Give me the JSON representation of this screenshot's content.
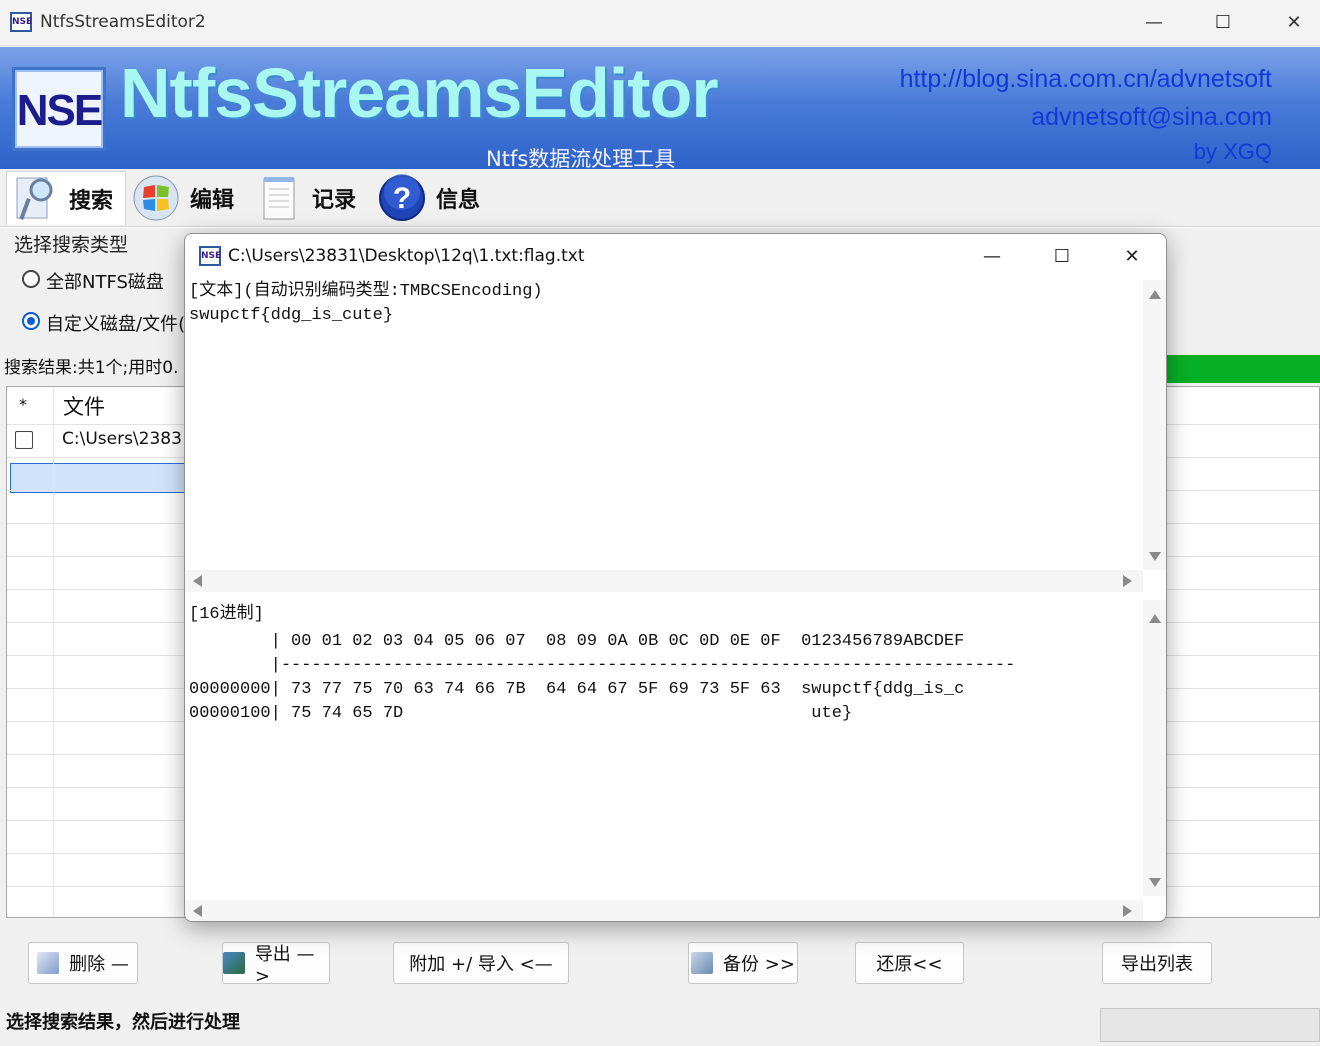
{
  "window": {
    "title": "NtfsStreamsEditor2",
    "minimize": "—",
    "maximize": "☐",
    "close": "✕"
  },
  "banner": {
    "logo_text": "NSE",
    "brand": "NtfsStreamsEditor",
    "subtitle": "Ntfs数据流处理工具",
    "link_blog": "http://blog.sina.com.cn/advnetsoft",
    "link_email": "advnetsoft@sina.com",
    "author": "by XGQ"
  },
  "toolbar": {
    "search": "搜索",
    "edit": "编辑",
    "record": "记录",
    "info": "信息"
  },
  "search_panel": {
    "group_label": "选择搜索类型",
    "option_all": "全部NTFS磁盘",
    "option_custom": "自定义磁盘/文件(",
    "selected": "option_custom",
    "result_summary": "搜索结果:共1个;用时0."
  },
  "grid": {
    "col_star": "*",
    "col_file": "文件",
    "rows": [
      {
        "checked": false,
        "path": "C:\\Users\\2383"
      }
    ]
  },
  "bottom_buttons": {
    "delete": "删除 —",
    "export": "导出 —>",
    "attach_import": "附加 +/ 导入 <—",
    "backup": "备份 >>",
    "restore": "还原<<",
    "export_list": "导出列表"
  },
  "status": {
    "text": "选择搜索结果，然后进行处理"
  },
  "dialog": {
    "title": "C:\\Users\\23831\\Desktop\\12q\\1.txt:flag.txt",
    "minimize": "—",
    "maximize": "☐",
    "close": "✕",
    "text_header": "[文本](自动识别编码类型:TMBCSEncoding)",
    "text_content": "swupctf{ddg_is_cute}",
    "hex_header": "[16进制]",
    "hex_column_header": "        | 00 01 02 03 04 05 06 07  08 09 0A 0B 0C 0D 0E 0F  0123456789ABCDEF",
    "hex_divider": "        |------------------------------------------------------------------------",
    "hex_rows": [
      "00000000| 73 77 75 70 63 74 66 7B  64 64 67 5F 69 73 5F 63  swupctf{ddg_is_c",
      "00000100| 75 74 65 7D                                        ute}"
    ]
  },
  "colors": {
    "banner_top": "#7aa2e8",
    "banner_bottom": "#2e62c9",
    "brand_text": "#a8f7f0",
    "link": "#1338d8",
    "progress_green": "#06b025",
    "selection": "#cfe3fb"
  },
  "icons": {
    "app": "nse-app-icon",
    "search": "magnifier-document-icon",
    "edit": "windows-orb-icon",
    "record": "notepad-icon",
    "info": "help-question-icon"
  }
}
